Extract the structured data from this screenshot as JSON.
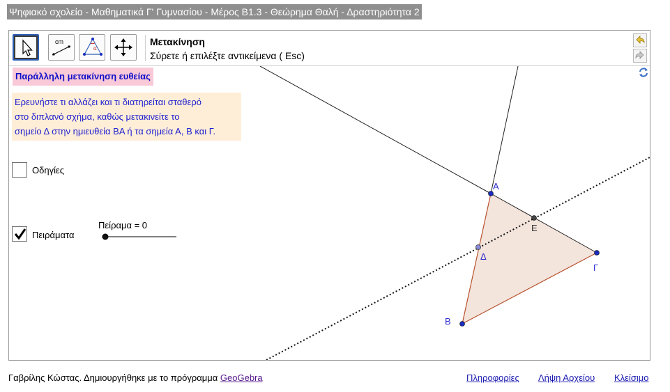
{
  "page": {
    "title": "Ψηφιακό σχολείο - Μαθηματικά Γ' Γυμνασίου - Μέρος Β1.3 - Θεώρημα Θαλή - Δραστηριότητα 2"
  },
  "toolbar": {
    "tools": [
      {
        "name": "move-tool",
        "icon": "arrow-pointer-icon",
        "selected": true
      },
      {
        "name": "distance-tool",
        "icon": "ruler-cm-icon",
        "label": "cm",
        "selected": false
      },
      {
        "name": "angle-tool",
        "icon": "angle-icon",
        "label": "α",
        "selected": false
      },
      {
        "name": "move-graphics-tool",
        "icon": "four-arrows-icon",
        "selected": false
      }
    ],
    "active_tool_name": "Μετακίνηση",
    "active_tool_help": "Σύρετε ή επιλέξτε αντικείμενα ( Esc)",
    "undo_icon": "undo-icon",
    "redo_icon": "redo-icon"
  },
  "panel": {
    "heading": "Παράλληλη μετακίνηση ευθείας",
    "info_lines": [
      "Ερευνήστε τι αλλάζει και τι διατηρείται σταθερό",
      "στο διπλανό σχήμα, καθώς μετακινείτε το",
      "σημείο Δ στην ημιευθεία ΒΑ ή τα σημεία Α, Β και Γ."
    ],
    "checkbox_instructions": {
      "label": "Οδηγίες",
      "checked": false
    },
    "checkbox_experiments": {
      "label": "Πειράματα",
      "checked": true
    },
    "slider": {
      "label": "Πείραμα = 0",
      "value": 0
    }
  },
  "figure": {
    "points": {
      "A": {
        "label": "Α"
      },
      "B": {
        "label": "Β"
      },
      "G": {
        "label": "Γ"
      },
      "D": {
        "label": "Δ"
      },
      "E": {
        "label": "Ε"
      }
    },
    "colors": {
      "triangle_fill": "#f3e4dc",
      "triangle_edge": "#b8522e",
      "point_fill": "#1a2dbf",
      "label": "#2b2bd0"
    }
  },
  "footer": {
    "credit_text": "Γαβρίλης Κώστας. Δημιουργήθηκε με το πρόγραμμα ",
    "credit_link": "GeoGebra",
    "links": {
      "info": "Πληροφορίες",
      "download": "Λήψη Αρχείου",
      "close": "Κλείσιμο"
    }
  }
}
